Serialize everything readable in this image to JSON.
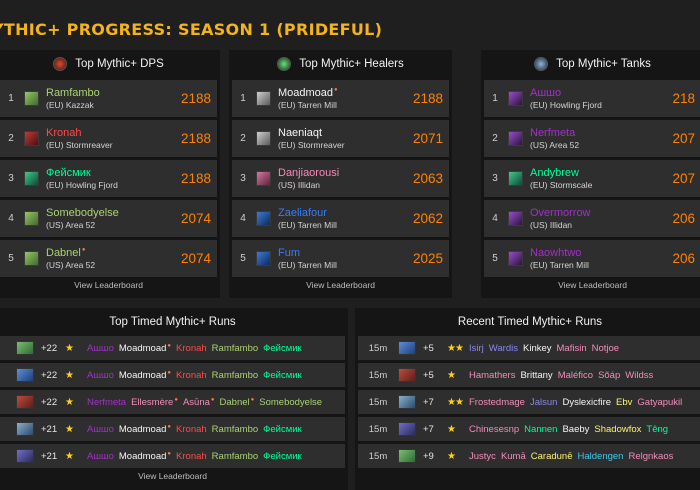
{
  "page_title": "YTHIC+ PROGRESS: SEASON 1 (PRIDEFUL)",
  "colors": {
    "accent": "#f3b31b",
    "score": "#ff8000",
    "panel": "#151515",
    "row": "#2e2e2e"
  },
  "leaderboards": [
    {
      "title": "Top Mythic+ DPS",
      "icon": "dps-icon",
      "view_label": "View Leaderboard",
      "rows": [
        {
          "rank": "1",
          "name": "Ramfambo",
          "realm": "(EU) Kazzak",
          "score": "2188",
          "cls": "hunter",
          "star": false
        },
        {
          "rank": "2",
          "name": "Kronah",
          "realm": "(EU) Stormreaver",
          "score": "2188",
          "cls": "dk",
          "star": false
        },
        {
          "rank": "3",
          "name": "Фейсмик",
          "realm": "(EU) Howling Fjord",
          "score": "2188",
          "cls": "monk",
          "star": false
        },
        {
          "rank": "4",
          "name": "Somebodyelse",
          "realm": "(US) Area 52",
          "score": "2074",
          "cls": "hunter",
          "star": false
        },
        {
          "rank": "5",
          "name": "Dabnel",
          "realm": "(US) Area 52",
          "score": "2074",
          "cls": "hunter",
          "star": true
        }
      ]
    },
    {
      "title": "Top Mythic+ Healers",
      "icon": "healer-icon",
      "view_label": "View Leaderboard",
      "rows": [
        {
          "rank": "1",
          "name": "Moadmoad",
          "realm": "(EU) Tarren Mill",
          "score": "2188",
          "cls": "priest",
          "star": true
        },
        {
          "rank": "2",
          "name": "Naeniaqt",
          "realm": "(EU) Stormreaver",
          "score": "2071",
          "cls": "priest",
          "star": false
        },
        {
          "rank": "3",
          "name": "Danjiaorousi",
          "realm": "(US) Illidan",
          "score": "2063",
          "cls": "pal",
          "star": false
        },
        {
          "rank": "4",
          "name": "Zaeliafour",
          "realm": "(EU) Tarren Mill",
          "score": "2062",
          "cls": "shaman",
          "star": false
        },
        {
          "rank": "5",
          "name": "Fum",
          "realm": "(EU) Tarren Mill",
          "score": "2025",
          "cls": "shaman",
          "star": false
        }
      ]
    },
    {
      "title": "Top Mythic+ Tanks",
      "icon": "tank-icon",
      "view_label": "View Leaderboard",
      "rows": [
        {
          "rank": "1",
          "name": "Ашшо",
          "realm": "(EU) Howling Fjord",
          "score": "218",
          "cls": "dh",
          "star": false
        },
        {
          "rank": "2",
          "name": "Nerfmeta",
          "realm": "(US) Area 52",
          "score": "207",
          "cls": "dh",
          "star": false
        },
        {
          "rank": "3",
          "name": "Andybrew",
          "realm": "(EU) Stormscale",
          "score": "207",
          "cls": "monk",
          "star": false
        },
        {
          "rank": "4",
          "name": "Overmorrow",
          "realm": "(US) Illidan",
          "score": "206",
          "cls": "dh",
          "star": false
        },
        {
          "rank": "5",
          "name": "Naowhtwo",
          "realm": "(EU) Tarren Mill",
          "score": "206",
          "cls": "dh",
          "star": false
        }
      ]
    }
  ],
  "top_runs": {
    "title": "Top Timed Mythic+ Runs",
    "view_label": "View Leaderboard",
    "rows": [
      {
        "level": "+22",
        "stars": "★",
        "members": [
          {
            "n": "Ашшо",
            "c": "dh"
          },
          {
            "n": "Moadmoad",
            "c": "priest",
            "s": true
          },
          {
            "n": "Kronah",
            "c": "dk"
          },
          {
            "n": "Ramfambo",
            "c": "hunter"
          },
          {
            "n": "Фейсмик",
            "c": "monk"
          }
        ]
      },
      {
        "level": "+22",
        "stars": "★",
        "members": [
          {
            "n": "Ашшо",
            "c": "dh"
          },
          {
            "n": "Moadmoad",
            "c": "priest",
            "s": true
          },
          {
            "n": "Kronah",
            "c": "dk"
          },
          {
            "n": "Ramfambo",
            "c": "hunter"
          },
          {
            "n": "Фейсмик",
            "c": "monk"
          }
        ]
      },
      {
        "level": "+22",
        "stars": "★",
        "members": [
          {
            "n": "Nerfmeta",
            "c": "dh"
          },
          {
            "n": "Ellesmère",
            "c": "pal",
            "s": true
          },
          {
            "n": "Asūna",
            "c": "pal",
            "s": true
          },
          {
            "n": "Dabnel",
            "c": "hunter",
            "s": true
          },
          {
            "n": "Somebodyelse",
            "c": "hunter"
          }
        ]
      },
      {
        "level": "+21",
        "stars": "★",
        "members": [
          {
            "n": "Ашшо",
            "c": "dh"
          },
          {
            "n": "Moadmoad",
            "c": "priest",
            "s": true
          },
          {
            "n": "Kronah",
            "c": "dk"
          },
          {
            "n": "Ramfambo",
            "c": "hunter"
          },
          {
            "n": "Фейсмик",
            "c": "monk"
          }
        ]
      },
      {
        "level": "+21",
        "stars": "★",
        "members": [
          {
            "n": "Ашшо",
            "c": "dh"
          },
          {
            "n": "Moadmoad",
            "c": "priest",
            "s": true
          },
          {
            "n": "Kronah",
            "c": "dk"
          },
          {
            "n": "Ramfambo",
            "c": "hunter"
          },
          {
            "n": "Фейсмик",
            "c": "monk"
          }
        ]
      }
    ]
  },
  "recent_runs": {
    "title": "Recent Timed Mythic+ Runs",
    "rows": [
      {
        "time": "15m",
        "level": "+5",
        "stars": "★★",
        "members": [
          {
            "n": "Isirj",
            "c": "warlock"
          },
          {
            "n": "Wardis",
            "c": "warlock"
          },
          {
            "n": "Kinkey",
            "c": "priest"
          },
          {
            "n": "Mafisin",
            "c": "pal"
          },
          {
            "n": "Notjoe",
            "c": "pal"
          }
        ]
      },
      {
        "time": "15m",
        "level": "+5",
        "stars": "★",
        "members": [
          {
            "n": "Hamathers",
            "c": "pal"
          },
          {
            "n": "Brittany",
            "c": "priest"
          },
          {
            "n": "Maléfico",
            "c": "pal"
          },
          {
            "n": "Sõáp",
            "c": "pal"
          },
          {
            "n": "Wildss",
            "c": "pal"
          }
        ]
      },
      {
        "time": "15m",
        "level": "+7",
        "stars": "★★",
        "members": [
          {
            "n": "Frostedmage",
            "c": "pal"
          },
          {
            "n": "Jalsun",
            "c": "warlock"
          },
          {
            "n": "Dyslexicfire",
            "c": "priest"
          },
          {
            "n": "Ebv",
            "c": "rogue"
          },
          {
            "n": "Gatyapukil",
            "c": "pal"
          }
        ]
      },
      {
        "time": "15m",
        "level": "+7",
        "stars": "★",
        "members": [
          {
            "n": "Chinesesnp",
            "c": "pal"
          },
          {
            "n": "Nannen",
            "c": "monk"
          },
          {
            "n": "Baeby",
            "c": "priest"
          },
          {
            "n": "Shadowfox",
            "c": "rogue"
          },
          {
            "n": "Têng",
            "c": "monk"
          }
        ]
      },
      {
        "time": "15m",
        "level": "+9",
        "stars": "★",
        "members": [
          {
            "n": "Justyc",
            "c": "pal"
          },
          {
            "n": "Kumā",
            "c": "pal"
          },
          {
            "n": "Caradunē",
            "c": "rogue"
          },
          {
            "n": "Haldengen",
            "c": "mage"
          },
          {
            "n": "Relgnkaos",
            "c": "pal"
          }
        ]
      }
    ]
  }
}
